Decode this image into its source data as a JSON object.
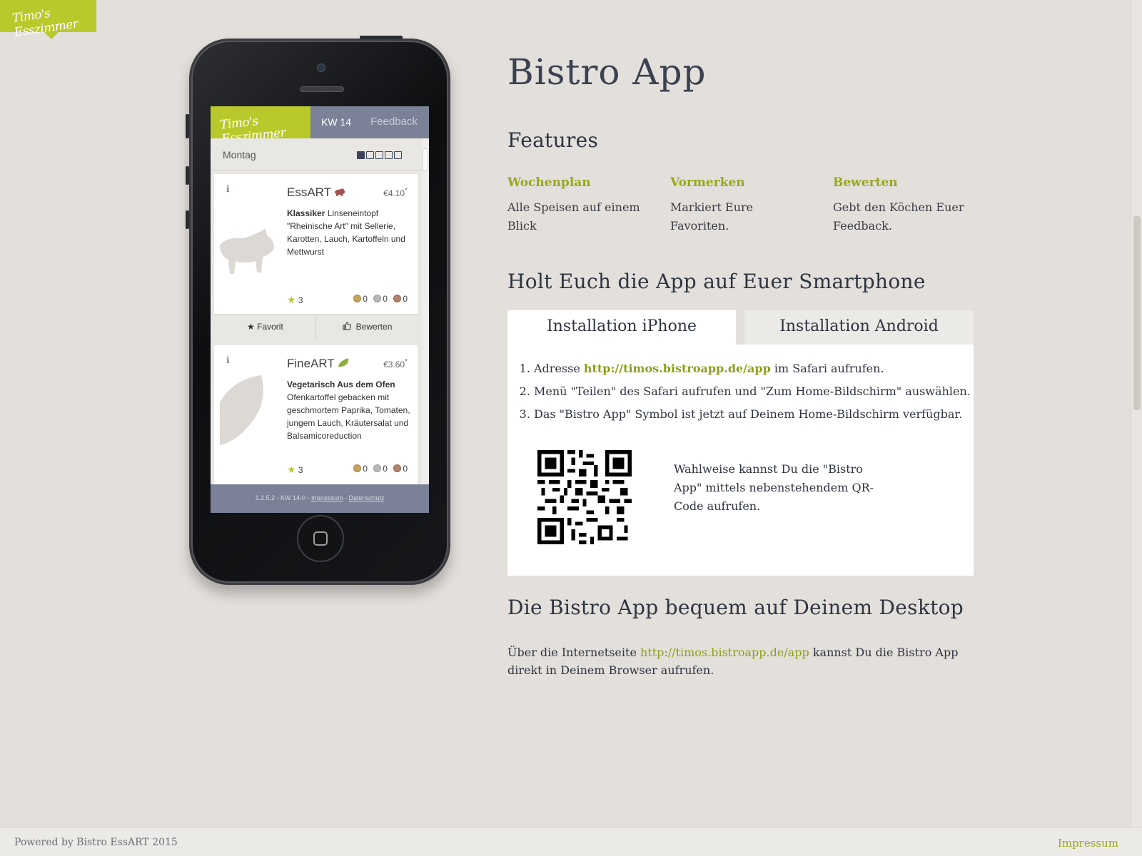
{
  "brand": {
    "logo_text": "Timo's Esszimmer"
  },
  "phone": {
    "app": {
      "logo_text": "Timo's Esszimmer",
      "week_label": "KW 14",
      "feedback_label": "Feedback",
      "day": "Montag",
      "cards": [
        {
          "info": "i",
          "name": "EssART",
          "price": "€4.10",
          "price_mark": "*",
          "desc_bold": "Klassiker",
          "desc": " Linseneintopf \"Rheinische Art\" mit Sellerie, Karotten, Lauch, Kartoffeln und Mettwurst",
          "rating": "3",
          "gold": "0",
          "silver": "0",
          "bronze": "0"
        },
        {
          "info": "i",
          "name": "FineART",
          "price": "€3.60",
          "price_mark": "*",
          "desc_bold": "Vegetarisch Aus dem Ofen",
          "desc": "Ofenkartoffel gebacken mit geschmortem Paprika, Tomaten, jungem Lauch, Kräutersalat und Balsamicoreduction",
          "rating": "3",
          "gold": "0",
          "silver": "0",
          "bronze": "0"
        }
      ],
      "actions": {
        "favorite": "Favorit",
        "rate": "Bewerten"
      },
      "footer": {
        "version": "1.2.5.2 - KW 14-0 - ",
        "impressum": "Impressum",
        "sep": " - ",
        "datenschutz": "Datenschutz"
      }
    }
  },
  "main": {
    "title": "Bistro App",
    "features_heading": "Features",
    "features": [
      {
        "title": "Wochenplan",
        "text": "Alle Speisen auf einem Blick"
      },
      {
        "title": "Vormerken",
        "text": "Markiert Eure Favoriten."
      },
      {
        "title": "Bewerten",
        "text": "Gebt den Köchen Euer Feedback."
      }
    ],
    "smartphone_heading": "Holt Euch die App auf Euer Smartphone",
    "tabs": {
      "iphone": "Installation iPhone",
      "android": "Installation Android"
    },
    "steps": {
      "s1_prefix": "Adresse ",
      "s1_link": "http://timos.bistroapp.de/app",
      "s1_suffix": " im Safari aufrufen.",
      "s2": "Menü \"Teilen\" des Safari aufrufen und \"Zum Home-Bildschirm\" auswählen.",
      "s3": "Das \"Bistro App\" Symbol ist jetzt auf Deinem Home-Bildschirm verfügbar."
    },
    "qr_text": "Wahlweise kannst Du die \"Bistro App\" mittels nebenstehendem QR-Code aufrufen.",
    "desktop_heading": "Die Bistro App bequem auf Deinem Desktop",
    "desktop": {
      "prefix": "Über die Internetseite ",
      "link": "http://timos.bistroapp.de/app",
      "suffix": " kannst Du die Bistro App direkt in Deinem Browser aufrufen."
    }
  },
  "footer": {
    "powered": "Powered by Bistro EssART 2015",
    "impressum": "Impressum"
  },
  "colors": {
    "accent": "#b9c82a",
    "link": "#8f9e1a",
    "app_nav": "#7b8196",
    "background": "#e3dfdb"
  },
  "icons": [
    "pig-icon",
    "leaf-icon",
    "star-icon",
    "thumbs-up-icon",
    "qr-code"
  ]
}
